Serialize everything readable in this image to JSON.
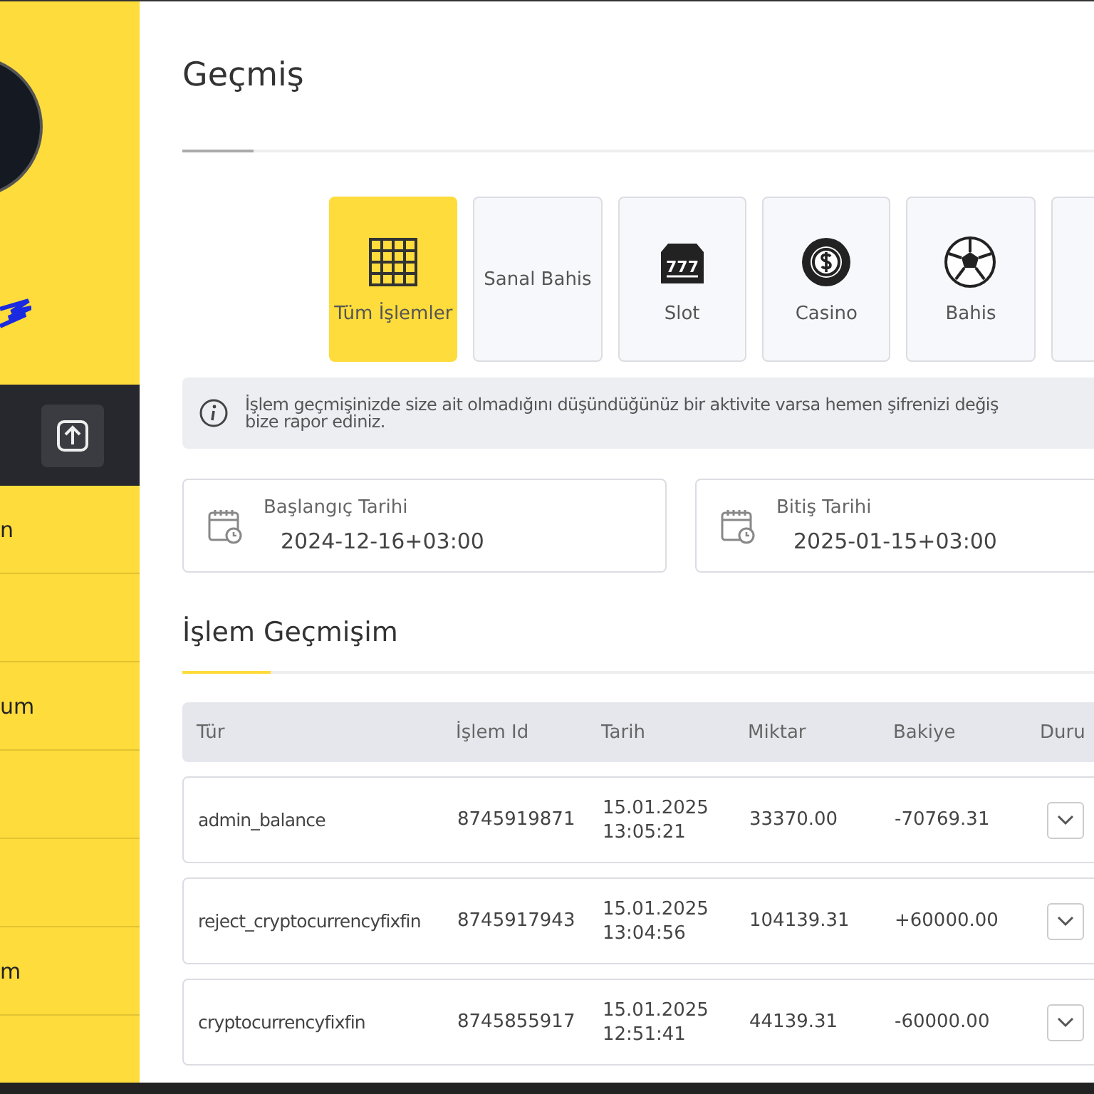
{
  "sidebar": {
    "items": [
      {
        "kind": "text",
        "label": "n"
      },
      {
        "kind": "blank"
      },
      {
        "kind": "text",
        "label": "um"
      },
      {
        "kind": "blank"
      },
      {
        "kind": "blank"
      },
      {
        "kind": "text",
        "label": "m"
      }
    ]
  },
  "page": {
    "title": "Geçmiş"
  },
  "tabs": [
    {
      "kind": "grid",
      "label": "Tüm İşlemler",
      "selected": true
    },
    {
      "kind": "text",
      "label": "Sanal Bahis",
      "selected": false
    },
    {
      "kind": "slot",
      "icon_text": "777",
      "label": "Slot",
      "selected": false
    },
    {
      "kind": "chip",
      "label": "Casino",
      "selected": false
    },
    {
      "kind": "ball",
      "label": "Bahis",
      "selected": false
    },
    {
      "kind": "blank",
      "selected": false
    }
  ],
  "notice": "İşlem geçmişinizde size ait olmadığını düşündüğünüz bir aktivite varsa hemen şifrenizi değiş\nbize rapor ediniz.",
  "dates": [
    {
      "label": "Başlangıç Tarihi",
      "value": "2024-12-16+03:00"
    },
    {
      "label": "Bitiş Tarihi",
      "value": "2025-01-15+03:00"
    }
  ],
  "history": {
    "title": "İşlem Geçmişim",
    "columns": [
      "Tür",
      "İşlem Id",
      "Tarih",
      "Miktar",
      "Bakiye",
      "Duru"
    ],
    "rows": [
      {
        "type": "admin_balance",
        "id": "8745919871",
        "date": "15.01.2025",
        "time": "13:05:21",
        "amount": "33370.00",
        "balance": "-70769.31"
      },
      {
        "type": "reject_cryptocurrencyfixfin",
        "id": "8745917943",
        "date": "15.01.2025",
        "time": "13:04:56",
        "amount": "104139.31",
        "balance": "+60000.00"
      },
      {
        "type": "cryptocurrencyfixfin",
        "id": "8745855917",
        "date": "15.01.2025",
        "time": "12:51:41",
        "amount": "44139.31",
        "balance": "-60000.00"
      }
    ]
  }
}
